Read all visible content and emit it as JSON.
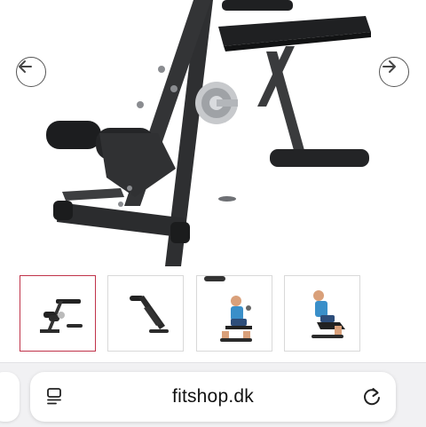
{
  "product_gallery": {
    "main_image": "adjustable-ab-back-bench-product-photo",
    "prev_icon": "arrow-left-icon",
    "next_icon": "arrow-right-icon",
    "selected_thumbnail_index": 0,
    "thumbnails": [
      "bench-front-view-thumbnail",
      "bench-folded-view-thumbnail",
      "bench-in-use-curl-thumbnail",
      "bench-in-use-extension-thumbnail"
    ],
    "selected_border_color": "#c0334a"
  },
  "browser": {
    "url": "fitshop.dk",
    "reader_icon": "reader-mode-icon",
    "reload_icon": "reload-icon"
  }
}
